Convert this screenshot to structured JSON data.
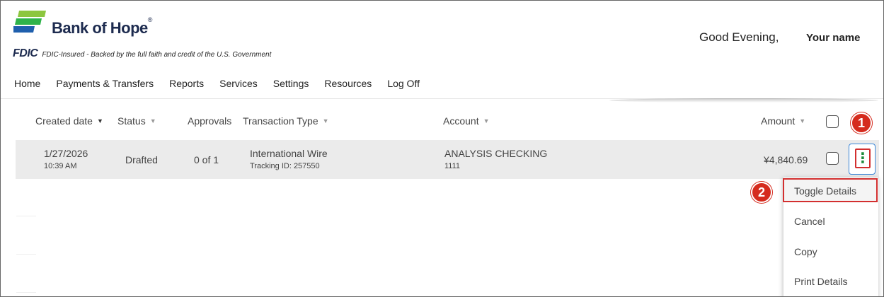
{
  "brand": {
    "name": "Bank of Hope",
    "trademark": "®",
    "fdic": "FDIC",
    "fdic_text": "FDIC-Insured - Backed by the full faith and credit of the U.S. Government",
    "colors": {
      "navy": "#1d2b4f",
      "green": "#2fb34a",
      "lime": "#8cc63f",
      "blue": "#1f5fad"
    }
  },
  "header": {
    "greeting": "Good Evening,",
    "username": "Your name"
  },
  "nav": {
    "items": [
      "Home",
      "Payments & Transfers",
      "Reports",
      "Services",
      "Settings",
      "Resources",
      "Log Off"
    ]
  },
  "table": {
    "headers": {
      "created_date": "Created date",
      "status": "Status",
      "approvals": "Approvals",
      "transaction_type": "Transaction Type",
      "account": "Account",
      "amount": "Amount"
    },
    "rows": [
      {
        "date": "1/27/2026",
        "time": "10:39 AM",
        "status": "Drafted",
        "approvals": "0 of 1",
        "type": "International Wire",
        "tracking": "Tracking ID: 257550",
        "account": "ANALYSIS CHECKING",
        "account_number": "1111",
        "amount": "¥4,840.69"
      }
    ]
  },
  "annotations": {
    "step1": "1",
    "step2": "2",
    "accent": "#d32f2f"
  },
  "dropdown": {
    "items": [
      "Toggle Details",
      "Cancel",
      "Copy",
      "Print Details"
    ]
  },
  "icons": {
    "menu": "vertical-ellipsis-icon",
    "sort": "caret-down-icon"
  }
}
